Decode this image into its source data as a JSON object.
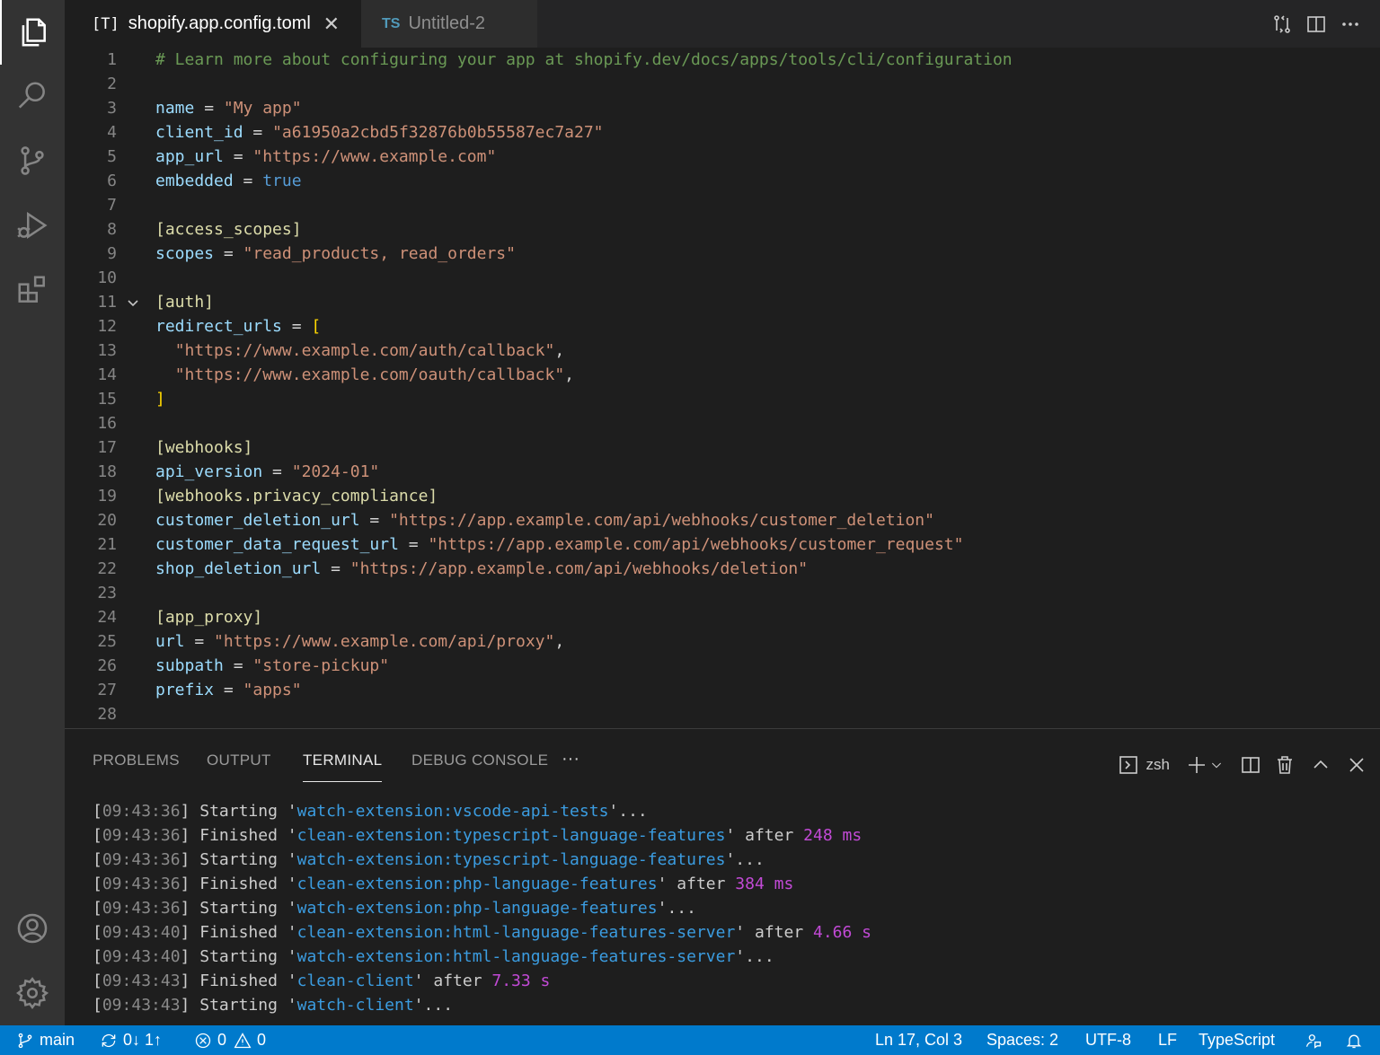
{
  "tabs": [
    {
      "icon": "[T]",
      "label": "shopify.app.config.toml",
      "close": "✕"
    },
    {
      "icon": "TS",
      "label": "Untitled-2"
    }
  ],
  "editor": {
    "lines": [
      {
        "n": "1",
        "segs": [
          [
            "t-comment",
            "# Learn more about configuring your app at shopify.dev/docs/apps/tools/cli/configuration"
          ]
        ]
      },
      {
        "n": "2",
        "segs": []
      },
      {
        "n": "3",
        "segs": [
          [
            "t-key",
            "name"
          ],
          [
            "t-op",
            " = "
          ],
          [
            "t-str",
            "\"My app\""
          ]
        ]
      },
      {
        "n": "4",
        "segs": [
          [
            "t-key",
            "client_id"
          ],
          [
            "t-op",
            " = "
          ],
          [
            "t-str",
            "\"a61950a2cbd5f32876b0b55587ec7a27\""
          ]
        ]
      },
      {
        "n": "5",
        "segs": [
          [
            "t-key",
            "app_url"
          ],
          [
            "t-op",
            " = "
          ],
          [
            "t-str",
            "\"https://www.example.com\""
          ]
        ]
      },
      {
        "n": "6",
        "segs": [
          [
            "t-key",
            "embedded"
          ],
          [
            "t-op",
            " = "
          ],
          [
            "t-bool",
            "true"
          ]
        ]
      },
      {
        "n": "7",
        "segs": []
      },
      {
        "n": "8",
        "segs": [
          [
            "t-sec",
            "[access_scopes]"
          ]
        ]
      },
      {
        "n": "9",
        "segs": [
          [
            "t-key",
            "scopes"
          ],
          [
            "t-op",
            " = "
          ],
          [
            "t-str",
            "\"read_products, read_orders\""
          ]
        ]
      },
      {
        "n": "10",
        "segs": []
      },
      {
        "n": "11",
        "fold": true,
        "segs": [
          [
            "t-sec",
            "[auth]"
          ]
        ]
      },
      {
        "n": "12",
        "segs": [
          [
            "t-key",
            "redirect_urls"
          ],
          [
            "t-op",
            " = "
          ],
          [
            "t-br",
            "["
          ]
        ]
      },
      {
        "n": "13",
        "segs": [
          [
            "t-op",
            "  "
          ],
          [
            "t-str",
            "\"https://www.example.com/auth/callback\""
          ],
          [
            "t-op",
            ","
          ]
        ]
      },
      {
        "n": "14",
        "segs": [
          [
            "t-op",
            "  "
          ],
          [
            "t-str",
            "\"https://www.example.com/oauth/callback\""
          ],
          [
            "t-op",
            ","
          ]
        ]
      },
      {
        "n": "15",
        "segs": [
          [
            "t-br",
            "]"
          ]
        ]
      },
      {
        "n": "16",
        "segs": []
      },
      {
        "n": "17",
        "segs": [
          [
            "t-sec",
            "[webhooks]"
          ]
        ]
      },
      {
        "n": "18",
        "segs": [
          [
            "t-key",
            "api_version"
          ],
          [
            "t-op",
            " = "
          ],
          [
            "t-str",
            "\"2024-01\""
          ]
        ]
      },
      {
        "n": "19",
        "segs": [
          [
            "t-sec",
            "[webhooks.privacy_compliance]"
          ]
        ]
      },
      {
        "n": "20",
        "segs": [
          [
            "t-key",
            "customer_deletion_url"
          ],
          [
            "t-op",
            " = "
          ],
          [
            "t-str",
            "\"https://app.example.com/api/webhooks/customer_deletion\""
          ]
        ]
      },
      {
        "n": "21",
        "segs": [
          [
            "t-key",
            "customer_data_request_url"
          ],
          [
            "t-op",
            " = "
          ],
          [
            "t-str",
            "\"https://app.example.com/api/webhooks/customer_request\""
          ]
        ]
      },
      {
        "n": "22",
        "segs": [
          [
            "t-key",
            "shop_deletion_url"
          ],
          [
            "t-op",
            " = "
          ],
          [
            "t-str",
            "\"https://app.example.com/api/webhooks/deletion\""
          ]
        ]
      },
      {
        "n": "23",
        "segs": []
      },
      {
        "n": "24",
        "segs": [
          [
            "t-sec",
            "[app_proxy]"
          ]
        ]
      },
      {
        "n": "25",
        "segs": [
          [
            "t-key",
            "url"
          ],
          [
            "t-op",
            " = "
          ],
          [
            "t-str",
            "\"https://www.example.com/api/proxy\""
          ],
          [
            "t-op",
            ","
          ]
        ]
      },
      {
        "n": "26",
        "segs": [
          [
            "t-key",
            "subpath"
          ],
          [
            "t-op",
            " = "
          ],
          [
            "t-str",
            "\"store-pickup\""
          ]
        ]
      },
      {
        "n": "27",
        "segs": [
          [
            "t-key",
            "prefix"
          ],
          [
            "t-op",
            " = "
          ],
          [
            "t-str",
            "\"apps\""
          ]
        ]
      },
      {
        "n": "28",
        "segs": []
      }
    ]
  },
  "panel": {
    "tabs": [
      "PROBLEMS",
      "OUTPUT",
      "TERMINAL",
      "DEBUG CONSOLE"
    ],
    "more": "···",
    "shell": "zsh",
    "terminal": [
      {
        "ts": "09:43:36",
        "verb": "Starting",
        "task": "watch-extension:vscode-api-tests",
        "tail": "..."
      },
      {
        "ts": "09:43:36",
        "verb": "Finished",
        "task": "clean-extension:typescript-language-features",
        "after": "248 ms"
      },
      {
        "ts": "09:43:36",
        "verb": "Starting",
        "task": "watch-extension:typescript-language-features",
        "tail": "..."
      },
      {
        "ts": "09:43:36",
        "verb": "Finished",
        "task": "clean-extension:php-language-features",
        "after": "384 ms"
      },
      {
        "ts": "09:43:36",
        "verb": "Starting",
        "task": "watch-extension:php-language-features",
        "tail": "..."
      },
      {
        "ts": "09:43:40",
        "verb": "Finished",
        "task": "clean-extension:html-language-features-server",
        "after": "4.66 s"
      },
      {
        "ts": "09:43:40",
        "verb": "Starting",
        "task": "watch-extension:html-language-features-server",
        "tail": "..."
      },
      {
        "ts": "09:43:43",
        "verb": "Finished",
        "task": "clean-client",
        "after": "7.33 s"
      },
      {
        "ts": "09:43:43",
        "verb": "Starting",
        "task": "watch-client",
        "tail": "..."
      }
    ]
  },
  "status": {
    "branch": "main",
    "sync": "0↓ 1↑",
    "errors": "0",
    "warnings": "0",
    "position": "Ln 17, Col 3",
    "spaces": "Spaces: 2",
    "encoding": "UTF-8",
    "eol": "LF",
    "language": "TypeScript"
  },
  "colors": {
    "accent": "#007acc",
    "string": "#ce9178",
    "key": "#9cdcfe",
    "comment": "#6a9955"
  }
}
